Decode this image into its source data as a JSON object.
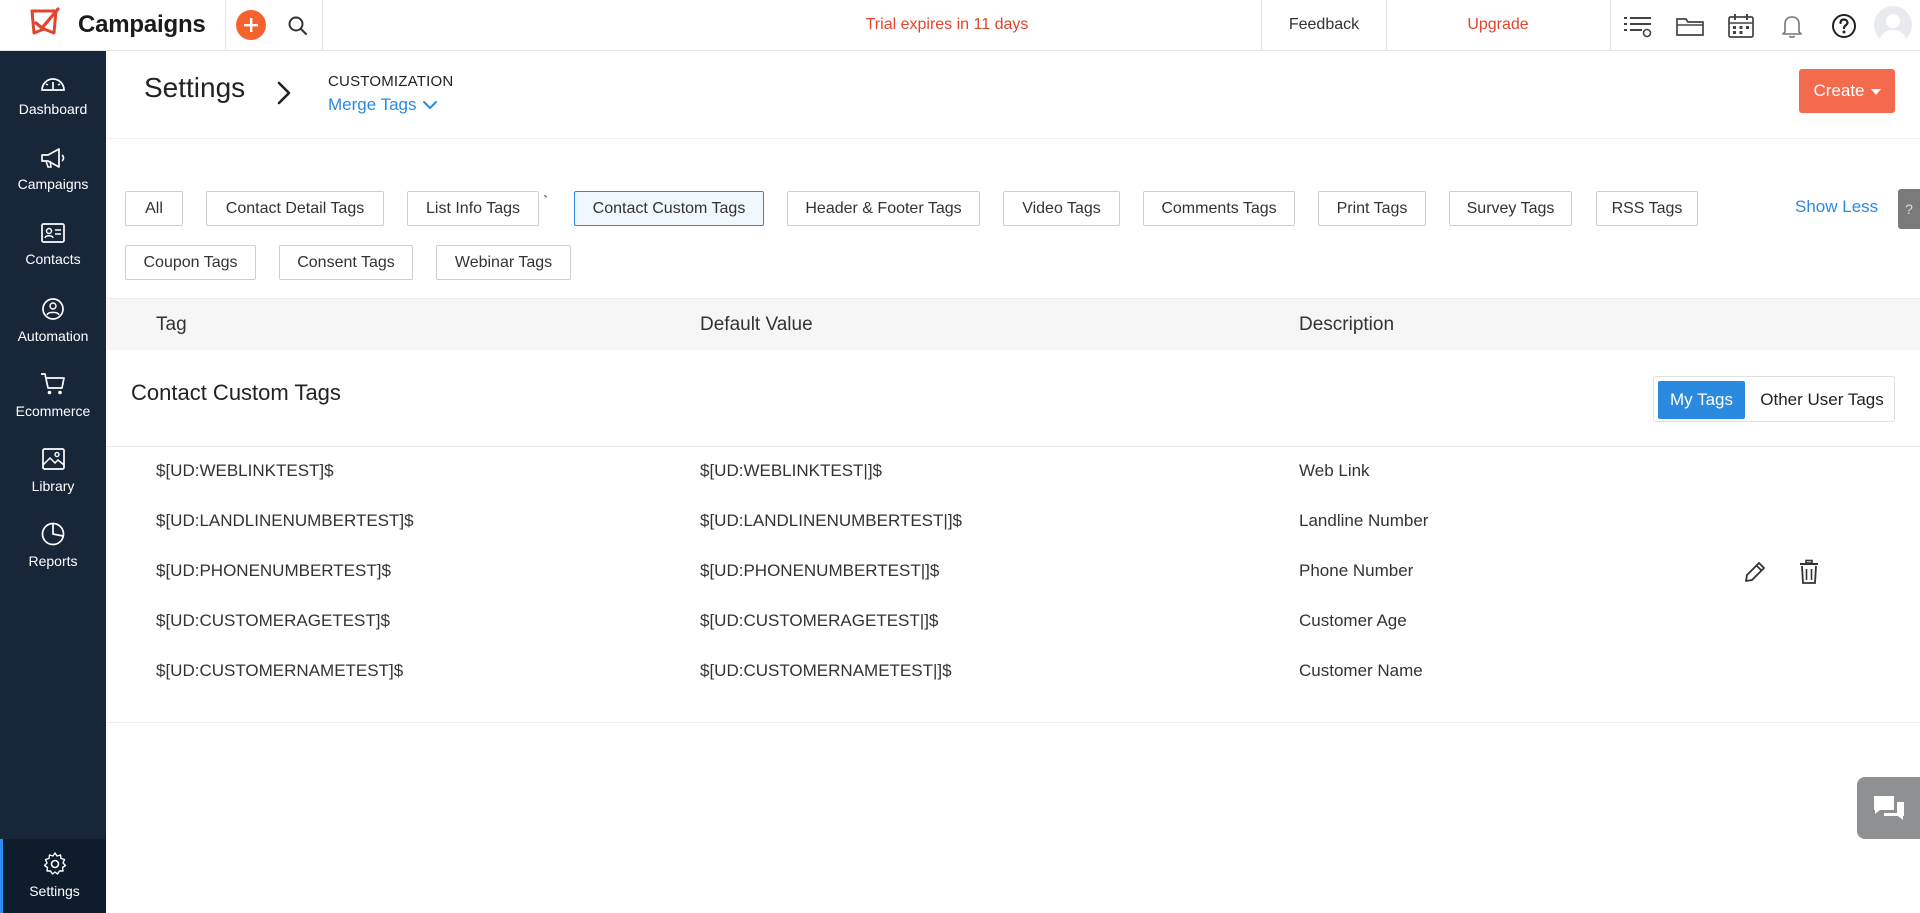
{
  "app": {
    "name": "Campaigns",
    "trial_text": "Trial expires in 11 days",
    "feedback_label": "Feedback",
    "upgrade_label": "Upgrade"
  },
  "sidebar": {
    "items": [
      {
        "label": "Dashboard",
        "icon": "dashboard-icon"
      },
      {
        "label": "Campaigns",
        "icon": "megaphone-icon"
      },
      {
        "label": "Contacts",
        "icon": "contact-card-icon"
      },
      {
        "label": "Automation",
        "icon": "automation-icon"
      },
      {
        "label": "Ecommerce",
        "icon": "cart-icon"
      },
      {
        "label": "Library",
        "icon": "image-library-icon"
      },
      {
        "label": "Reports",
        "icon": "pie-chart-icon"
      }
    ],
    "settings": {
      "label": "Settings",
      "icon": "gear-icon"
    }
  },
  "header": {
    "title": "Settings",
    "breadcrumb_section": "CUSTOMIZATION",
    "breadcrumb_current": "Merge Tags",
    "create_label": "Create"
  },
  "filters": {
    "row1": [
      "All",
      "Contact Detail Tags",
      "List Info Tags",
      "Contact Custom Tags",
      "Header & Footer Tags",
      "Video Tags",
      "Comments Tags",
      "Print Tags",
      "Survey Tags",
      "RSS Tags"
    ],
    "row2": [
      "Coupon Tags",
      "Consent Tags",
      "Webinar Tags"
    ],
    "backtick": "`",
    "selected": "Contact Custom Tags",
    "show_less_label": "Show Less",
    "help_label": "?"
  },
  "table": {
    "headers": {
      "tag": "Tag",
      "default": "Default Value",
      "description": "Description"
    },
    "section_title": "Contact Custom Tags",
    "toggle": {
      "my_tags": "My Tags",
      "other_user_tags": "Other User Tags",
      "active": "My Tags"
    },
    "rows": [
      {
        "tag": "$[UD:WEBLINKTEST]$",
        "default": "$[UD:WEBLINKTEST|]$",
        "description": "Web Link"
      },
      {
        "tag": "$[UD:LANDLINENUMBERTEST]$",
        "default": "$[UD:LANDLINENUMBERTEST|]$",
        "description": "Landline Number"
      },
      {
        "tag": "$[UD:PHONENUMBERTEST]$",
        "default": "$[UD:PHONENUMBERTEST|]$",
        "description": "Phone Number"
      },
      {
        "tag": "$[UD:CUSTOMERAGETEST]$",
        "default": "$[UD:CUSTOMERAGETEST|]$",
        "description": "Customer Age"
      },
      {
        "tag": "$[UD:CUSTOMERNAMETEST]$",
        "default": "$[UD:CUSTOMERNAMETEST|]$",
        "description": "Customer Name"
      }
    ]
  },
  "colors": {
    "sidebar_bg": "#18263a",
    "accent_blue": "#2a8ae0",
    "brand_orange": "#f36a4d",
    "alert_red": "#e0452d"
  }
}
